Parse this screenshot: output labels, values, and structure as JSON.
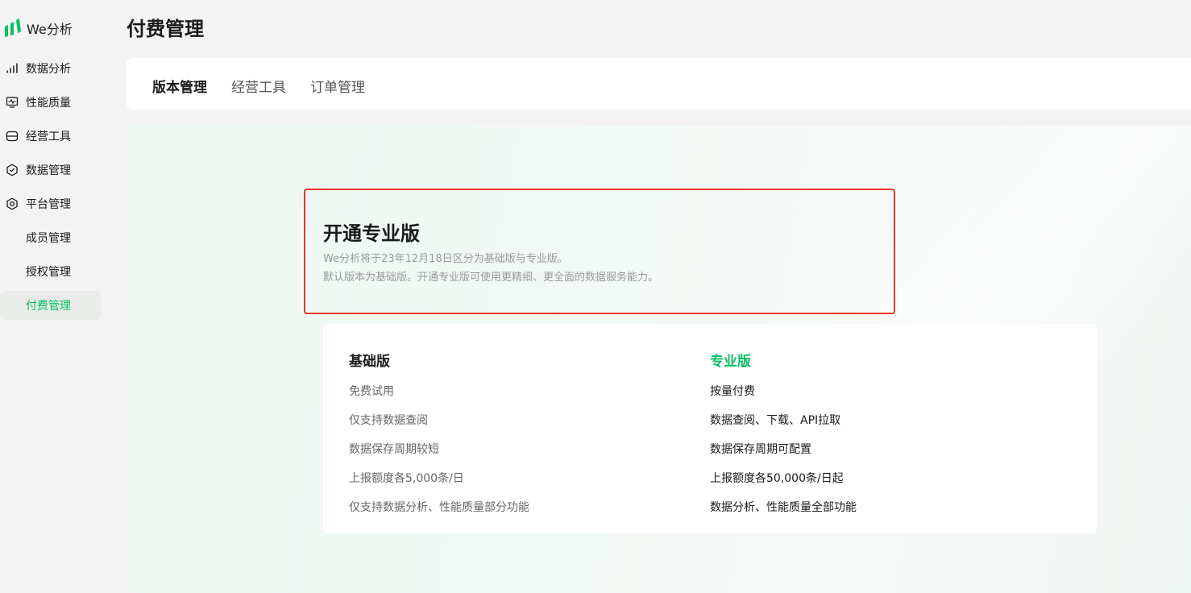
{
  "brand": {
    "name": "We分析",
    "logo_color": "#07c160"
  },
  "sidebar": {
    "items": [
      {
        "label": "数据分析",
        "icon": "bar-chart-icon"
      },
      {
        "label": "性能质量",
        "icon": "monitor-pulse-icon"
      },
      {
        "label": "经营工具",
        "icon": "drawer-icon"
      },
      {
        "label": "数据管理",
        "icon": "hexagon-check-icon"
      },
      {
        "label": "平台管理",
        "icon": "gear-icon"
      },
      {
        "label": "成员管理",
        "icon": ""
      },
      {
        "label": "授权管理",
        "icon": ""
      },
      {
        "label": "付费管理",
        "icon": "",
        "active": true
      }
    ]
  },
  "page": {
    "title": "付费管理"
  },
  "tabs": [
    {
      "label": "版本管理",
      "active": true
    },
    {
      "label": "经营工具",
      "active": false
    },
    {
      "label": "订单管理",
      "active": false
    }
  ],
  "hero": {
    "title": "开通专业版",
    "desc_line1": "We分析将于23年12月18日区分为基础版与专业版。",
    "desc_line2": "默认版本为基础版。开通专业版可使用更精细、更全面的数据服务能力。"
  },
  "plans": {
    "basic": {
      "title": "基础版",
      "features": [
        "免费试用",
        "仅支持数据查阅",
        "数据保存周期较短",
        "上报额度各5,000条/日",
        "仅支持数据分析、性能质量部分功能"
      ]
    },
    "pro": {
      "title": "专业版",
      "features": [
        "按量付费",
        "数据查阅、下载、API拉取",
        "数据保存周期可配置",
        "上报额度各50,000条/日起",
        "数据分析、性能质量全部功能"
      ]
    }
  },
  "colors": {
    "accent": "#07c160",
    "highlight_border": "#e8392a"
  }
}
